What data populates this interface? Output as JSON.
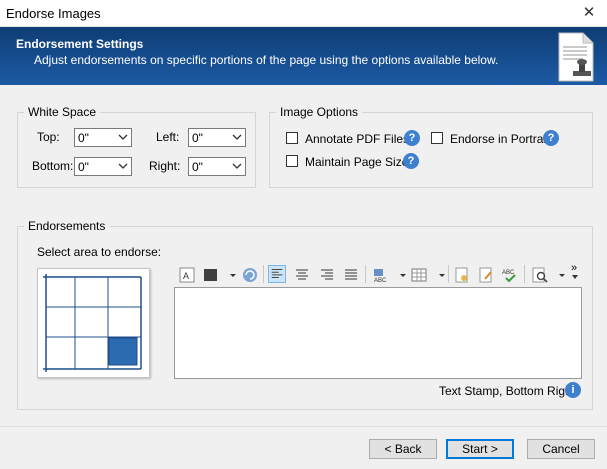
{
  "window": {
    "title": "Endorse Images",
    "close_glyph": "✕"
  },
  "banner": {
    "heading": "Endorsement Settings",
    "subtitle": "Adjust endorsements on specific portions of the page using the options available below."
  },
  "white_space": {
    "legend": "White Space",
    "top_label": "Top:",
    "top_value": "0\"",
    "bottom_label": "Bottom:",
    "bottom_value": "0\"",
    "left_label": "Left:",
    "left_value": "0\"",
    "right_label": "Right:",
    "right_value": "0\""
  },
  "image_options": {
    "legend": "Image Options",
    "annotate_label": "Annotate PDF Files",
    "portrait_label": "Endorse in Portrait",
    "maintain_label": "Maintain Page Size",
    "help_glyph": "?"
  },
  "endorsements": {
    "legend": "Endorsements",
    "select_area_label": "Select area to endorse:",
    "selected_cell": "bottom-right",
    "stamp_status": "Text Stamp, Bottom Right",
    "info_glyph": "i",
    "editor_text": ""
  },
  "toolbar": {
    "icons": [
      "font-icon",
      "color-icon",
      "refresh-icon",
      "align-left-icon",
      "align-center-icon",
      "align-right-icon",
      "justify-icon",
      "insert-field-icon",
      "table-icon",
      "stamp-icon",
      "edit-stamp-icon",
      "spellcheck-icon",
      "preview-icon",
      "more-icon"
    ],
    "more_glyph": "»"
  },
  "footer": {
    "back_label": "< Back",
    "start_label": "Start >",
    "cancel_label": "Cancel"
  }
}
